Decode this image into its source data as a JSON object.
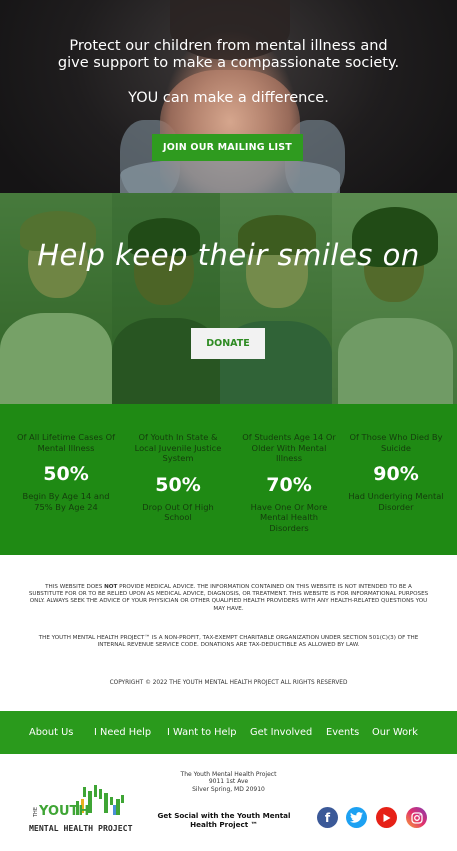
{
  "hero": {
    "line1": "Protect our children from mental illness and",
    "line2": "give support to make a compassionate society.",
    "line3": "YOU can make a difference.",
    "join_label": "JOIN OUR MAILING LIST"
  },
  "smiles": {
    "title": "Help keep their smiles on",
    "donate_label": "DONATE"
  },
  "stats": [
    {
      "label": "Of All Lifetime Cases Of Mental Illness",
      "percent": "50%",
      "desc": "Begin By Age 14 and 75% By Age 24"
    },
    {
      "label": "Of Youth In State & Local Juvenile Justice System",
      "percent": "50%",
      "desc": "Drop Out Of High School"
    },
    {
      "label": "Of Students Age 14 Or Older With Mental Illness",
      "percent": "70%",
      "desc": "Have One Or More Mental Health Disorders"
    },
    {
      "label": "Of Those Who Died By Suicide",
      "percent": "90%",
      "desc": "Had Underlying Mental Disorder"
    }
  ],
  "disclaimer": {
    "pre": "THIS WEBSITE DOES ",
    "not": "NOT",
    "post": " PROVIDE MEDICAL ADVICE. THE INFORMATION CONTAINED ON THIS WEBSITE IS NOT INTENDED TO BE A SUBSTITUTE FOR OR TO BE RELIED UPON AS MEDICAL ADVICE, DIAGNOSIS, OR TREATMENT. THIS WEBSITE IS FOR INFORMATIONAL PURPOSES ONLY. ALWAYS SEEK THE ADVICE OF YOUR PHYSICIAN OR OTHER QUALIFIED HEALTH PROVIDERS WITH ANY HEALTH-RELATED QUESTIONS YOU MAY HAVE.",
    "nonprofit": "THE YOUTH MENTAL HEALTH PROJECT™ IS A NON-PROFIT, TAX-EXEMPT CHARITABLE ORGANIZATION UNDER SECTION 501(C)(3) OF THE INTERNAL REVENUE SERVICE CODE. DONATIONS ARE TAX-DEDUCTIBLE AS ALLOWED BY LAW."
  },
  "copyright": "COPYRIGHT © 2022 THE YOUTH MENTAL HEALTH PROJECT ALL RIGHTS RESERVED",
  "nav": {
    "about": "About Us",
    "help": "I Need Help",
    "want_help": "I Want to Help",
    "involved": "Get Involved",
    "events": "Events",
    "work": "Our Work"
  },
  "address": {
    "name": "The Youth Mental Health Project",
    "street": "9011 1st Ave",
    "city": "Silver Spring, MD 20910"
  },
  "logo": {
    "the": "THE",
    "youth": "YOUTH",
    "rest": "MENTAL HEALTH PROJECT"
  },
  "social": {
    "text": "Get Social with the Youth Mental Health Project ™",
    "icons": [
      "facebook-icon",
      "twitter-icon",
      "youtube-icon",
      "instagram-icon"
    ]
  },
  "colors": {
    "brand_green": "#2a9a1c",
    "button_green": "#2f9b1f",
    "stats_green": "#1f8a14",
    "facebook": "#3b5998",
    "twitter": "#1da1f2",
    "youtube": "#e62117",
    "instagram": "#c13584"
  }
}
